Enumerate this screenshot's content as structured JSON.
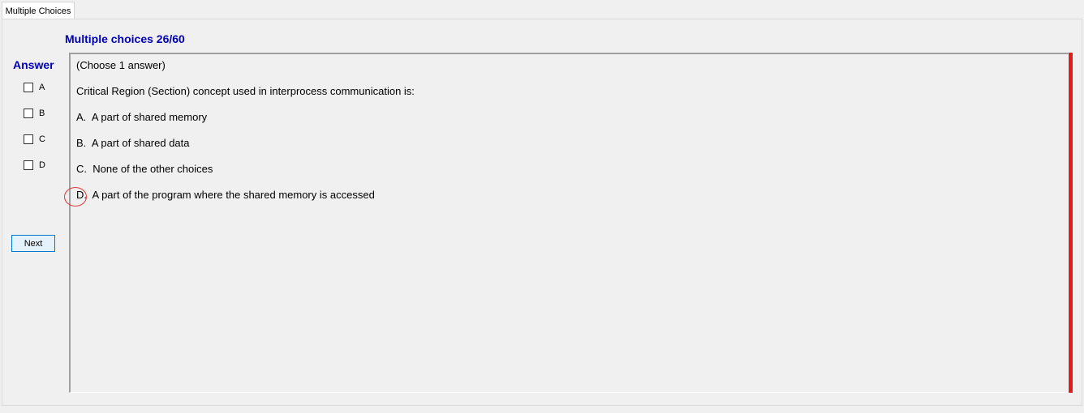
{
  "tab": {
    "label": "Multiple Choices"
  },
  "header": {
    "title": "Multiple choices 26/60"
  },
  "answer_panel": {
    "label": "Answer",
    "options": [
      {
        "letter": "A",
        "checked": false
      },
      {
        "letter": "B",
        "checked": false
      },
      {
        "letter": "C",
        "checked": false
      },
      {
        "letter": "D",
        "checked": false
      }
    ],
    "next_label": "Next"
  },
  "question": {
    "instruction": "(Choose 1 answer)",
    "text": "Critical Region (Section) concept used in interprocess communication is:",
    "choices": [
      {
        "letter": "A.",
        "text": "A part of shared memory"
      },
      {
        "letter": "B.",
        "text": "A part of shared data"
      },
      {
        "letter": "C.",
        "text": "None of  the other choices"
      },
      {
        "letter": "D.",
        "text": "A part of the program where the shared memory is accessed"
      }
    ]
  },
  "colors": {
    "accent_blue": "#0000b4",
    "scroll_marker": "#e21b1b",
    "annotation_circle": "#e23a3a"
  }
}
